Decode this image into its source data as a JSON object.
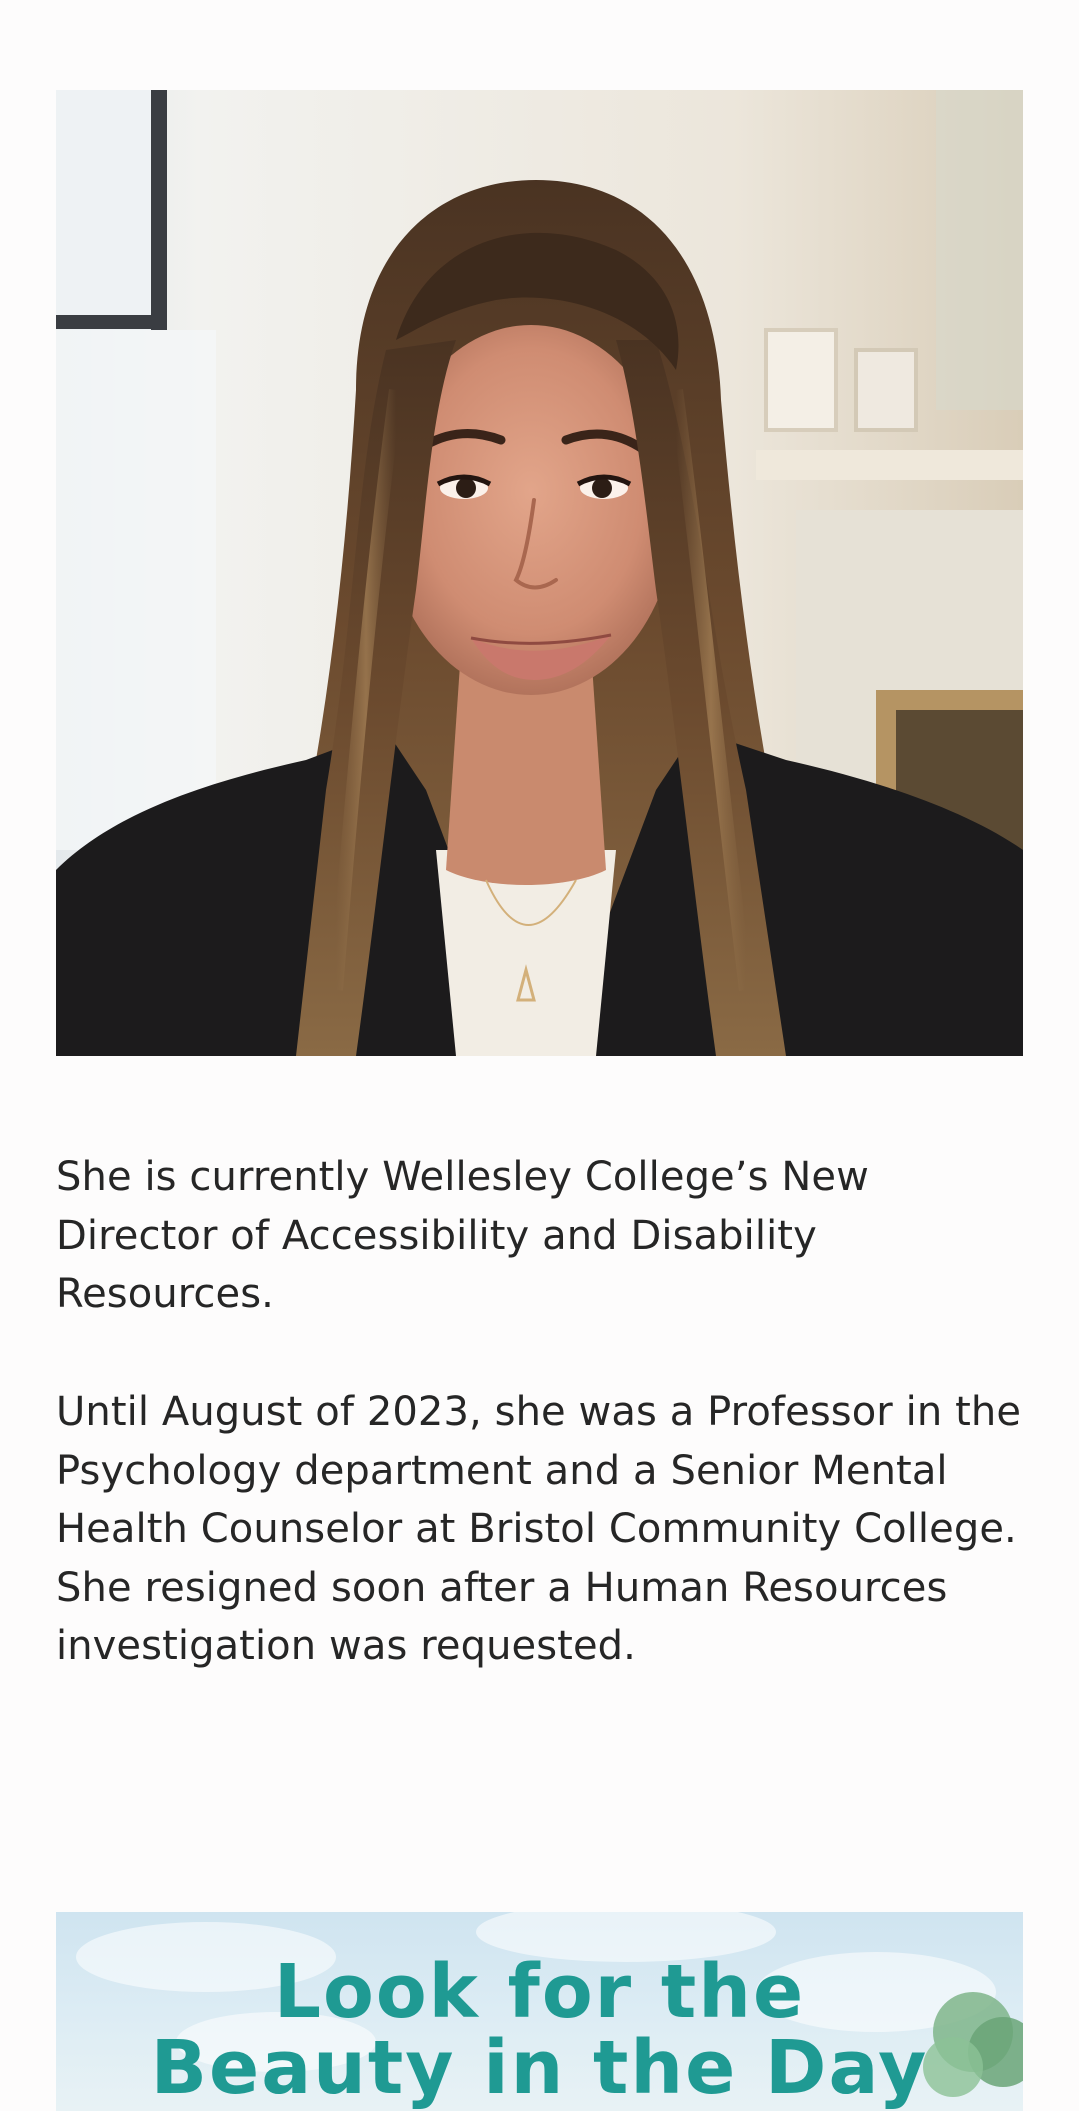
{
  "article": {
    "portrait": {
      "alt": "Portrait of a woman with long brown hair wearing a black blazer"
    },
    "paragraphs": [
      "She is currently Wellesley College’s New Director of Accessibility and Disability Resources.",
      "Until August of 2023, she was a Professor in the Psychology department and a Senior Mental Health Counselor at Bristol Community College. She resigned soon after a Human Resources investigation was requested."
    ],
    "banner": {
      "line_1": "Look for the",
      "line_2": "Beauty in the Day",
      "text_color": "#1f9a93"
    }
  }
}
